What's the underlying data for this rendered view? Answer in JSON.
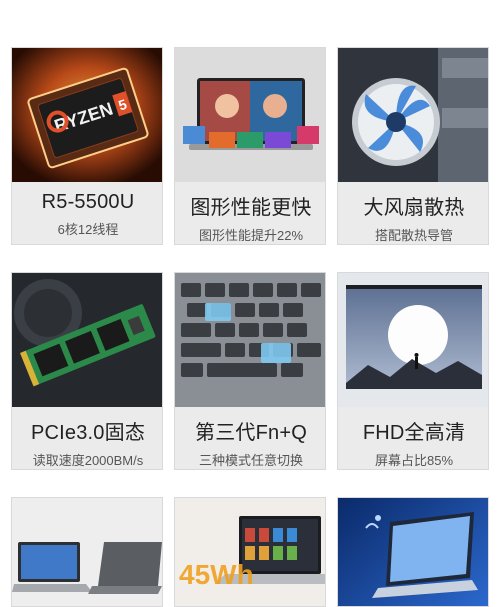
{
  "cards": [
    {
      "title": "R5-5500U",
      "subtitle": "6核12线程",
      "image_label": "RYZEN",
      "image_sub": "5",
      "icon": "cpu-chip-icon"
    },
    {
      "title": "图形性能更快",
      "subtitle": "图形性能提升22%",
      "icon": "laptop-screen-icon"
    },
    {
      "title": "大风扇散热",
      "subtitle": "搭配散热导管",
      "icon": "fan-icon"
    },
    {
      "title": "PCIe3.0固态",
      "subtitle": "读取速度2000BM/s",
      "icon": "ssd-icon"
    },
    {
      "title": "第三代Fn+Q",
      "subtitle": "三种模式任意切换",
      "icon": "keyboard-icon"
    },
    {
      "title": "FHD全高清",
      "subtitle": "屏幕占比85%",
      "icon": "display-icon"
    },
    {
      "title": "",
      "subtitle": "",
      "icon": "laptops-icon"
    },
    {
      "title": "",
      "subtitle": "",
      "image_label": "45Wh",
      "icon": "battery-laptop-icon"
    },
    {
      "title": "",
      "subtitle": "",
      "icon": "blue-laptop-icon"
    }
  ]
}
